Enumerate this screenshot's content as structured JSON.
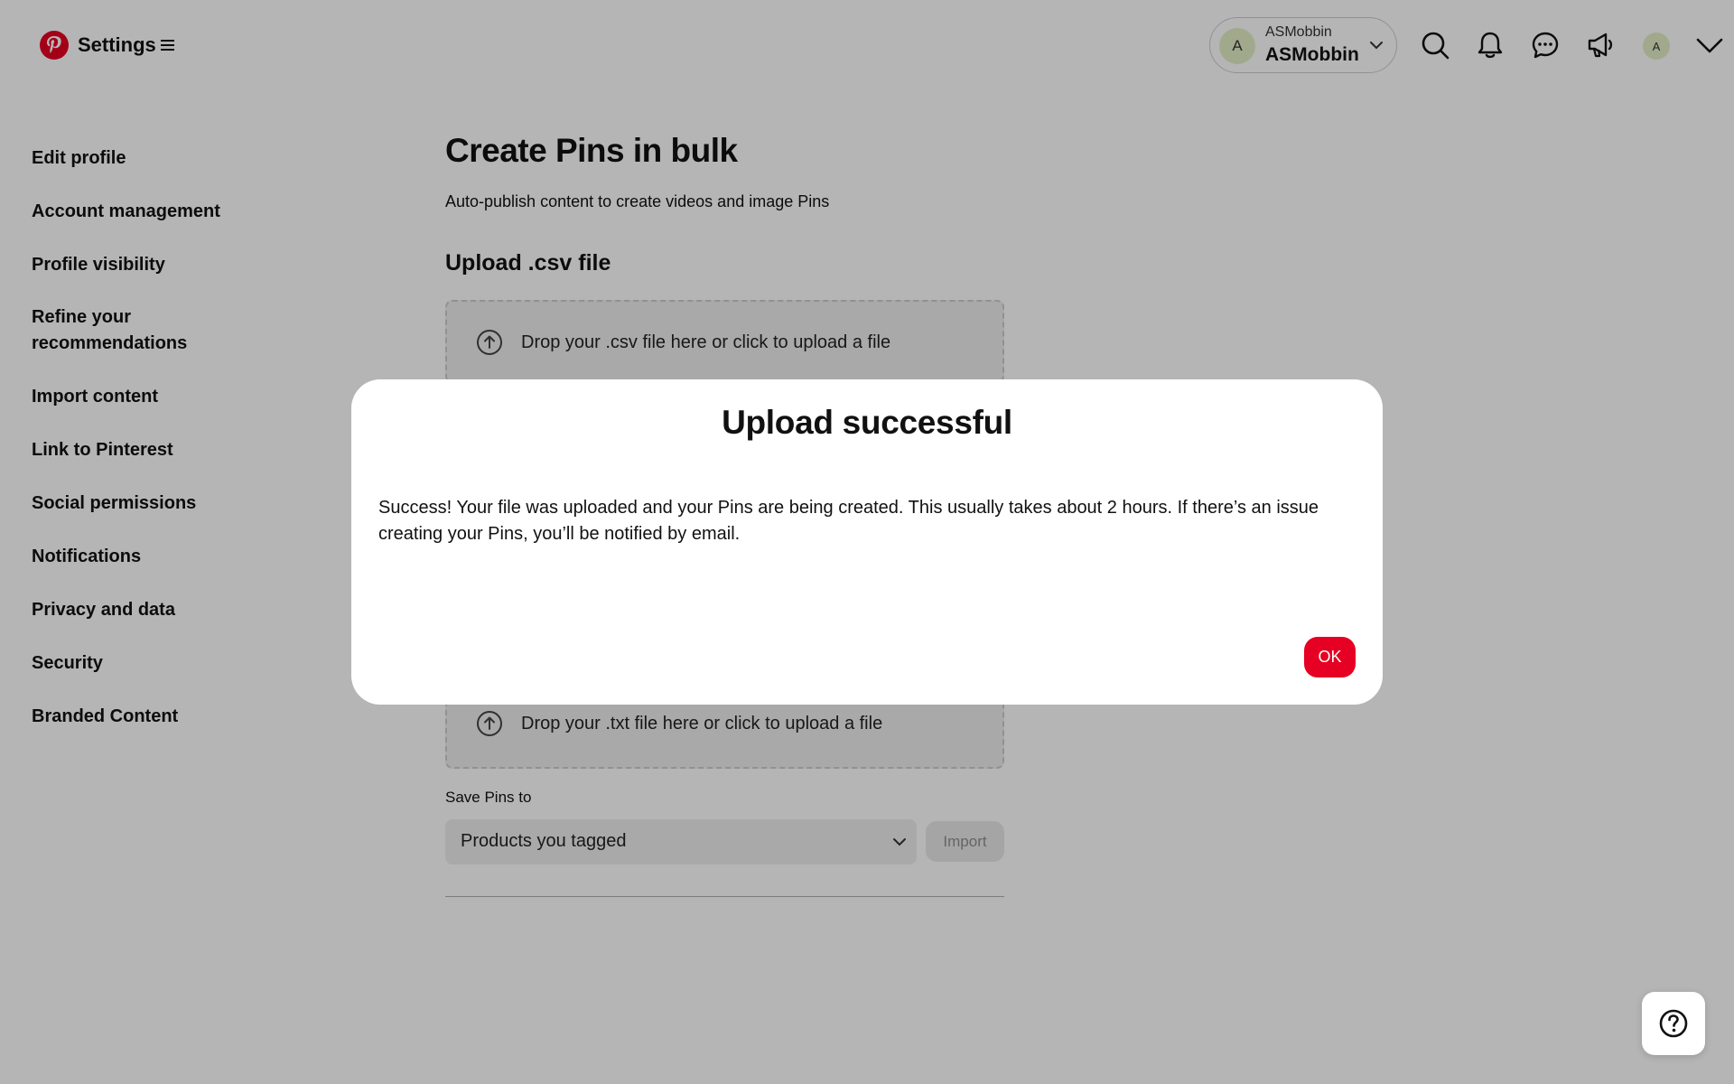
{
  "header": {
    "settings_title": "Settings",
    "account": {
      "avatar_letter": "A",
      "username_small": "ASMobbin",
      "username": "ASMobbin"
    },
    "small_avatar_letter": "A",
    "icons": [
      "pinterest-logo-icon",
      "menu-icon",
      "search-icon",
      "bell-icon",
      "messages-icon",
      "megaphone-icon",
      "chevron-down-icon"
    ]
  },
  "sidebar": {
    "items": [
      {
        "label": "Edit profile"
      },
      {
        "label": "Account management"
      },
      {
        "label": "Profile visibility"
      },
      {
        "label": "Refine your recommendations"
      },
      {
        "label": "Import content"
      },
      {
        "label": "Link to Pinterest"
      },
      {
        "label": "Social permissions"
      },
      {
        "label": "Notifications"
      },
      {
        "label": "Privacy and data"
      },
      {
        "label": "Security"
      },
      {
        "label": "Branded Content"
      }
    ]
  },
  "main": {
    "title": "Create Pins in bulk",
    "subtitle": "Auto-publish content to create videos and image Pins",
    "upload_title": "Upload .csv file",
    "csv_drop_text": "Drop your .csv file here or click to upload a file",
    "txt_drop_text": "Drop your .txt file here or click to upload a file",
    "save_label": "Save Pins to",
    "select_value": "Products you tagged",
    "import_label": "Import"
  },
  "modal": {
    "title": "Upload successful",
    "body": "Success! Your file was uploaded and your Pins are being created. This usually takes about 2 hours. If there’s an issue creating your Pins, you’ll be notified by email.",
    "ok_label": "OK"
  },
  "colors": {
    "brand": "#e60023",
    "avatar_bg": "#e3efc7",
    "overlay": "rgba(0,0,0,0.29)"
  }
}
